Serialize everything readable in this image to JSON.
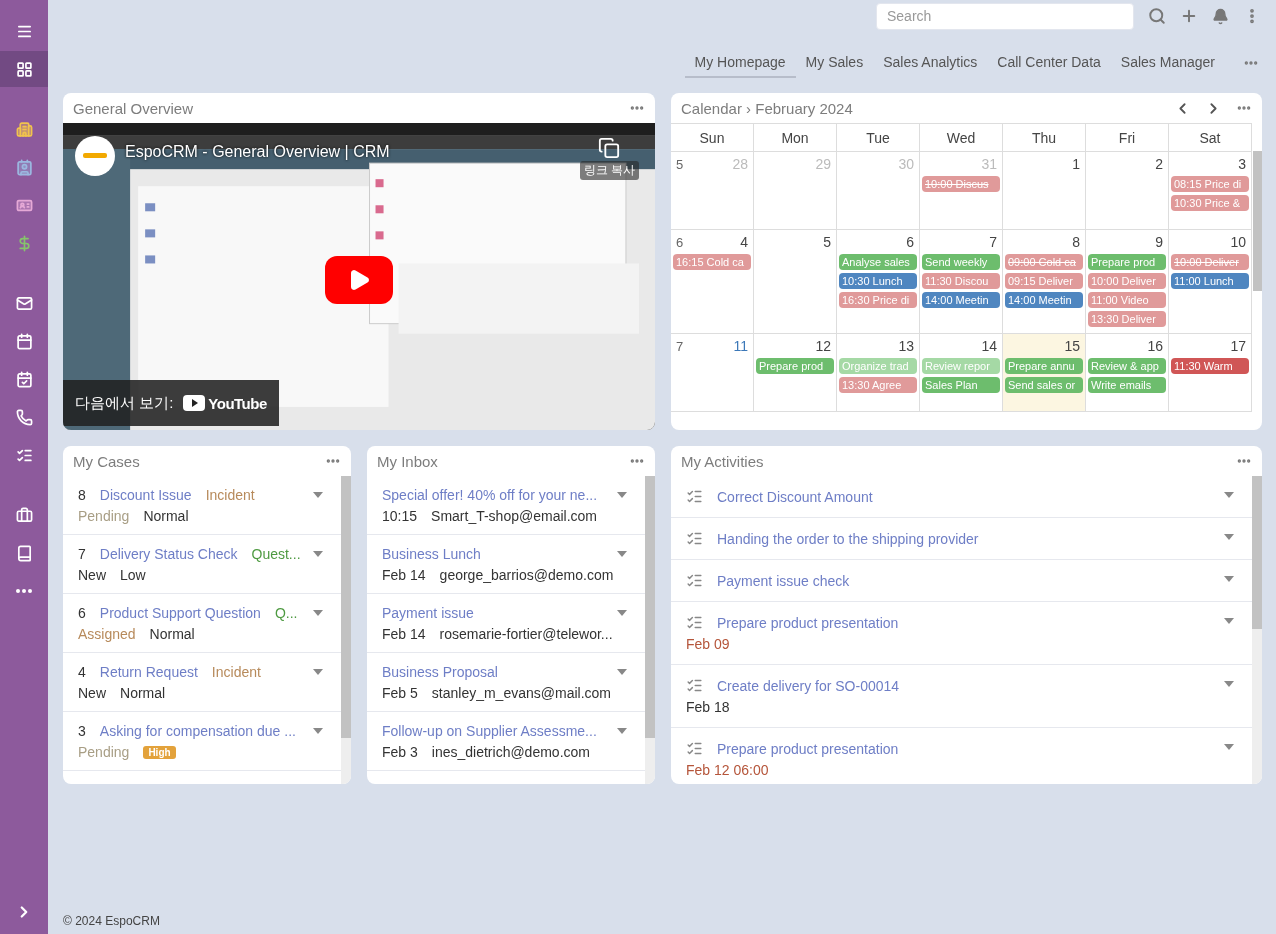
{
  "sidebar": {
    "items": [
      {
        "kind": "menu",
        "selected": false
      },
      {
        "kind": "dashboard",
        "selected": true
      },
      {
        "kind": "gap"
      },
      {
        "kind": "building",
        "selected": false
      },
      {
        "kind": "contact",
        "selected": false
      },
      {
        "kind": "card",
        "selected": false
      },
      {
        "kind": "dollar",
        "selected": false
      },
      {
        "kind": "gap"
      },
      {
        "kind": "mail",
        "selected": false
      },
      {
        "kind": "calendar",
        "selected": false
      },
      {
        "kind": "calendar-check",
        "selected": false
      },
      {
        "kind": "phone",
        "selected": false
      },
      {
        "kind": "tasks",
        "selected": false
      },
      {
        "kind": "gap"
      },
      {
        "kind": "briefcase",
        "selected": false
      },
      {
        "kind": "book",
        "selected": false
      },
      {
        "kind": "more",
        "selected": false
      }
    ]
  },
  "search": {
    "placeholder": "Search"
  },
  "tabs": [
    {
      "label": "My Homepage",
      "selected": true
    },
    {
      "label": "My Sales",
      "selected": false
    },
    {
      "label": "Sales Analytics",
      "selected": false
    },
    {
      "label": "Call Center Data",
      "selected": false
    },
    {
      "label": "Sales Manager",
      "selected": false
    }
  ],
  "video": {
    "title": "General Overview",
    "video_title": "EspoCRM - General Overview | CRM",
    "copy_label": "링크 복사",
    "watch_on": "다음에서 보기:",
    "brand": "YouTube"
  },
  "calendar": {
    "title": "Calendar",
    "separator": "›",
    "month": "February 2024",
    "weekdays": [
      "Sun",
      "Mon",
      "Tue",
      "Wed",
      "Thu",
      "Fri",
      "Sat"
    ],
    "weeks": [
      {
        "number": "5",
        "days": [
          {
            "label": "28",
            "muted": true,
            "today": false,
            "accent": false
          },
          {
            "label": "29",
            "muted": true,
            "today": false,
            "accent": false
          },
          {
            "label": "30",
            "muted": true,
            "today": false,
            "accent": false
          },
          {
            "label": "31",
            "muted": true,
            "today": false,
            "accent": false,
            "events": [
              {
                "text": "10:00 Discus",
                "color": "#e09a9a",
                "struck": true
              }
            ]
          },
          {
            "label": "1",
            "muted": false,
            "today": false,
            "accent": false
          },
          {
            "label": "2",
            "muted": false,
            "today": false,
            "accent": false
          },
          {
            "label": "3",
            "muted": false,
            "today": false,
            "accent": false,
            "events": [
              {
                "text": "08:15 Price di",
                "color": "#e09a9a",
                "struck": false
              },
              {
                "text": "10:30 Price &",
                "color": "#e09a9a",
                "struck": false
              }
            ]
          }
        ]
      },
      {
        "number": "6",
        "days": [
          {
            "label": "4",
            "muted": false,
            "today": false,
            "accent": false,
            "events": [
              {
                "text": "16:15 Cold ca",
                "color": "#e09a9a",
                "struck": false
              }
            ]
          },
          {
            "label": "5",
            "muted": false,
            "today": false,
            "accent": false
          },
          {
            "label": "6",
            "muted": false,
            "today": false,
            "accent": false,
            "events": [
              {
                "text": "Analyse sales",
                "color": "#6dbd6d",
                "struck": false
              },
              {
                "text": "10:30 Lunch",
                "color": "#4f86c0",
                "struck": false
              },
              {
                "text": "16:30 Price di",
                "color": "#e09a9a",
                "struck": false
              }
            ]
          },
          {
            "label": "7",
            "muted": false,
            "today": false,
            "accent": false,
            "events": [
              {
                "text": "Send weekly",
                "color": "#6dbd6d",
                "struck": false
              },
              {
                "text": "11:30 Discou",
                "color": "#e09a9a",
                "struck": false
              },
              {
                "text": "14:00 Meetin",
                "color": "#4f86c0",
                "struck": false
              }
            ]
          },
          {
            "label": "8",
            "muted": false,
            "today": false,
            "accent": false,
            "events": [
              {
                "text": "09:00 Cold ca",
                "color": "#e09a9a",
                "struck": true
              },
              {
                "text": "09:15 Deliver",
                "color": "#e09a9a",
                "struck": false
              },
              {
                "text": "14:00 Meetin",
                "color": "#4f86c0",
                "struck": false
              }
            ]
          },
          {
            "label": "9",
            "muted": false,
            "today": false,
            "accent": false,
            "events": [
              {
                "text": "Prepare prod",
                "color": "#6dbd6d",
                "struck": false
              },
              {
                "text": "10:00 Deliver",
                "color": "#e09a9a",
                "struck": false
              },
              {
                "text": "11:00 Video",
                "color": "#e09a9a",
                "struck": false
              },
              {
                "text": "13:30 Deliver",
                "color": "#e09a9a",
                "struck": false
              }
            ]
          },
          {
            "label": "10",
            "muted": false,
            "today": false,
            "accent": false,
            "events": [
              {
                "text": "10:00 Deliver",
                "color": "#e09a9a",
                "struck": true
              },
              {
                "text": "11:00 Lunch",
                "color": "#4f86c0",
                "struck": false
              }
            ]
          }
        ]
      },
      {
        "number": "7",
        "days": [
          {
            "label": "11",
            "muted": false,
            "today": false,
            "accent": true
          },
          {
            "label": "12",
            "muted": false,
            "today": false,
            "accent": false,
            "events": [
              {
                "text": "Prepare prod",
                "color": "#6dbd6d",
                "struck": false
              }
            ]
          },
          {
            "label": "13",
            "muted": false,
            "today": false,
            "accent": false,
            "events": [
              {
                "text": "Organize trad",
                "color": "#a5d9a5",
                "struck": false
              },
              {
                "text": "13:30 Agree",
                "color": "#e09a9a",
                "struck": false
              }
            ]
          },
          {
            "label": "14",
            "muted": false,
            "today": false,
            "accent": false,
            "events": [
              {
                "text": "Review repor",
                "color": "#a5d9a5",
                "struck": false
              },
              {
                "text": "Sales Plan",
                "color": "#6dbd6d",
                "struck": false
              }
            ]
          },
          {
            "label": "15",
            "muted": false,
            "today": true,
            "accent": false,
            "events": [
              {
                "text": "Prepare annu",
                "color": "#6dbd6d",
                "struck": false
              },
              {
                "text": "Send sales or",
                "color": "#6dbd6d",
                "struck": false
              }
            ]
          },
          {
            "label": "16",
            "muted": false,
            "today": false,
            "accent": false,
            "events": [
              {
                "text": "Review & app",
                "color": "#6dbd6d",
                "struck": false
              },
              {
                "text": "Write emails",
                "color": "#6dbd6d",
                "struck": false
              }
            ]
          },
          {
            "label": "17",
            "muted": false,
            "today": false,
            "accent": false,
            "events": [
              {
                "text": "11:30 Warm",
                "color": "#d05656",
                "struck": false
              }
            ]
          }
        ]
      }
    ]
  },
  "cases": {
    "title": "My Cases",
    "rows": [
      {
        "number": "8",
        "name": "Discount Issue",
        "type": {
          "text": "Incident",
          "kind": "incident"
        },
        "status": {
          "text": "Pending",
          "kind": "pending"
        },
        "priority": {
          "text": "Normal",
          "kind": "normal"
        }
      },
      {
        "number": "7",
        "name": "Delivery Status Check",
        "type": {
          "text": "Quest...",
          "kind": "question"
        },
        "status": {
          "text": "New",
          "kind": "new"
        },
        "priority": {
          "text": "Low",
          "kind": "low"
        }
      },
      {
        "number": "6",
        "name": "Product Support Question",
        "type": {
          "text": "Q...",
          "kind": "question"
        },
        "status": {
          "text": "Assigned",
          "kind": "assigned"
        },
        "priority": {
          "text": "Normal",
          "kind": "normal"
        }
      },
      {
        "number": "4",
        "name": "Return Request",
        "type": {
          "text": "Incident",
          "kind": "incident"
        },
        "status": {
          "text": "New",
          "kind": "new"
        },
        "priority": {
          "text": "Normal",
          "kind": "normal"
        }
      },
      {
        "number": "3",
        "name": "Asking for compensation due ...",
        "status": {
          "text": "Pending",
          "kind": "pending"
        },
        "priority": {
          "text": "High",
          "kind": "high"
        }
      }
    ]
  },
  "inbox": {
    "title": "My Inbox",
    "rows": [
      {
        "subject": "Special offer! 40% off for your ne...",
        "date": "10:15",
        "from": "Smart_T-shop@email.com"
      },
      {
        "subject": "Business Lunch",
        "date": "Feb 14",
        "from": "george_barrios@demo.com"
      },
      {
        "subject": "Payment issue",
        "date": "Feb 14",
        "from": "rosemarie-fortier@telewor..."
      },
      {
        "subject": "Business Proposal",
        "date": "Feb 5",
        "from": "stanley_m_evans@mail.com"
      },
      {
        "subject": "Follow-up on Supplier Assessme...",
        "date": "Feb 3",
        "from": "ines_dietrich@demo.com"
      }
    ]
  },
  "activities": {
    "title": "My Activities",
    "rows": [
      {
        "name": "Correct Discount Amount"
      },
      {
        "name": "Handing the order to the shipping provider"
      },
      {
        "name": "Payment issue check"
      },
      {
        "name": "Prepare product presentation",
        "date": "Feb 09",
        "overdue": true
      },
      {
        "name": "Create delivery for SO-00014",
        "date": "Feb 18",
        "overdue": false
      },
      {
        "name": "Prepare product presentation",
        "date": "Feb 12 06:00",
        "overdue": true
      }
    ]
  },
  "footer": "© 2024 EspoCRM"
}
